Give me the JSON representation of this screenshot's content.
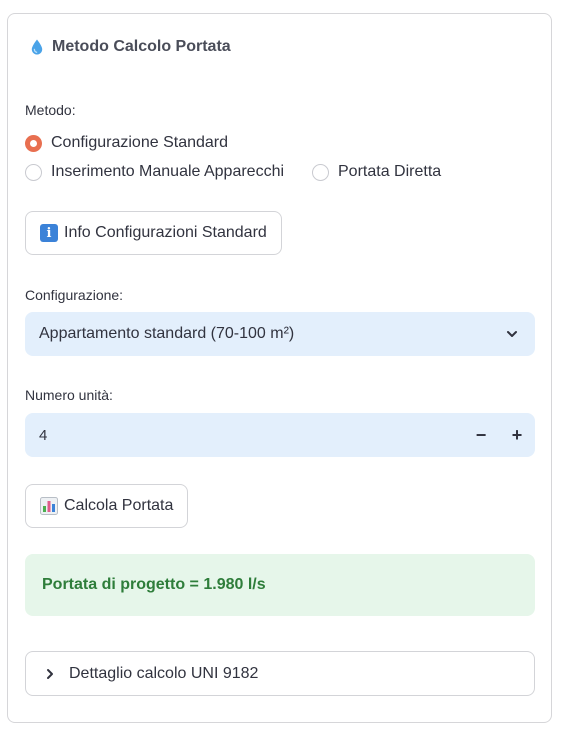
{
  "header": {
    "title": "Metodo Calcolo Portata",
    "icon": "water-drop-icon"
  },
  "method": {
    "label": "Metodo:",
    "options": [
      {
        "label": "Configurazione Standard",
        "selected": true
      },
      {
        "label": "Inserimento Manuale Apparecchi",
        "selected": false
      },
      {
        "label": "Portata Diretta",
        "selected": false
      }
    ]
  },
  "info_button": {
    "label": "Info Configurazioni Standard",
    "icon": "info-icon"
  },
  "configuration": {
    "label": "Configurazione:",
    "selected": "Appartamento standard (70-100 m²)"
  },
  "units": {
    "label": "Numero unità:",
    "value": "4",
    "minus": "−",
    "plus": "+"
  },
  "calc_button": {
    "label": "Calcola Portata",
    "icon": "bar-chart-icon"
  },
  "result": {
    "text": "Portata di progetto = 1.980 l/s"
  },
  "details": {
    "label": "Dettaglio calcolo UNI 9182"
  },
  "colors": {
    "accent": "#e86f50",
    "input_bg": "#e3effc",
    "success_bg": "#e6f6ea",
    "success_text": "#2e7d3a"
  }
}
